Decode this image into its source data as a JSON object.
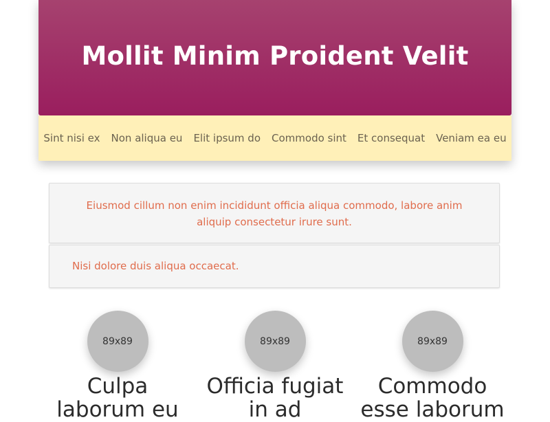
{
  "header": {
    "title": "Mollit Minim Proident Velit"
  },
  "nav": {
    "items": [
      "Sint nisi ex",
      "Non aliqua eu",
      "Elit ipsum do",
      "Commodo sint",
      "Et consequat",
      "Veniam ea eu"
    ]
  },
  "alerts": [
    "Eiusmod cillum non enim incididunt officia aliqua commodo, labore anim aliquip consectetur irure sunt.",
    "Nisi dolore duis aliqua occaecat."
  ],
  "features": [
    {
      "placeholder": "89x89",
      "heading": "Culpa laborum eu"
    },
    {
      "placeholder": "89x89",
      "heading": "Officia fugiat in ad"
    },
    {
      "placeholder": "89x89",
      "heading": "Commodo esse laborum"
    }
  ],
  "colors": {
    "hero_top": "#a6426f",
    "hero_bottom": "#9a1e5e",
    "nav_bg": "#fff0b8",
    "alert_text": "#e06c4c",
    "placeholder_bg": "#bdbdbd"
  }
}
